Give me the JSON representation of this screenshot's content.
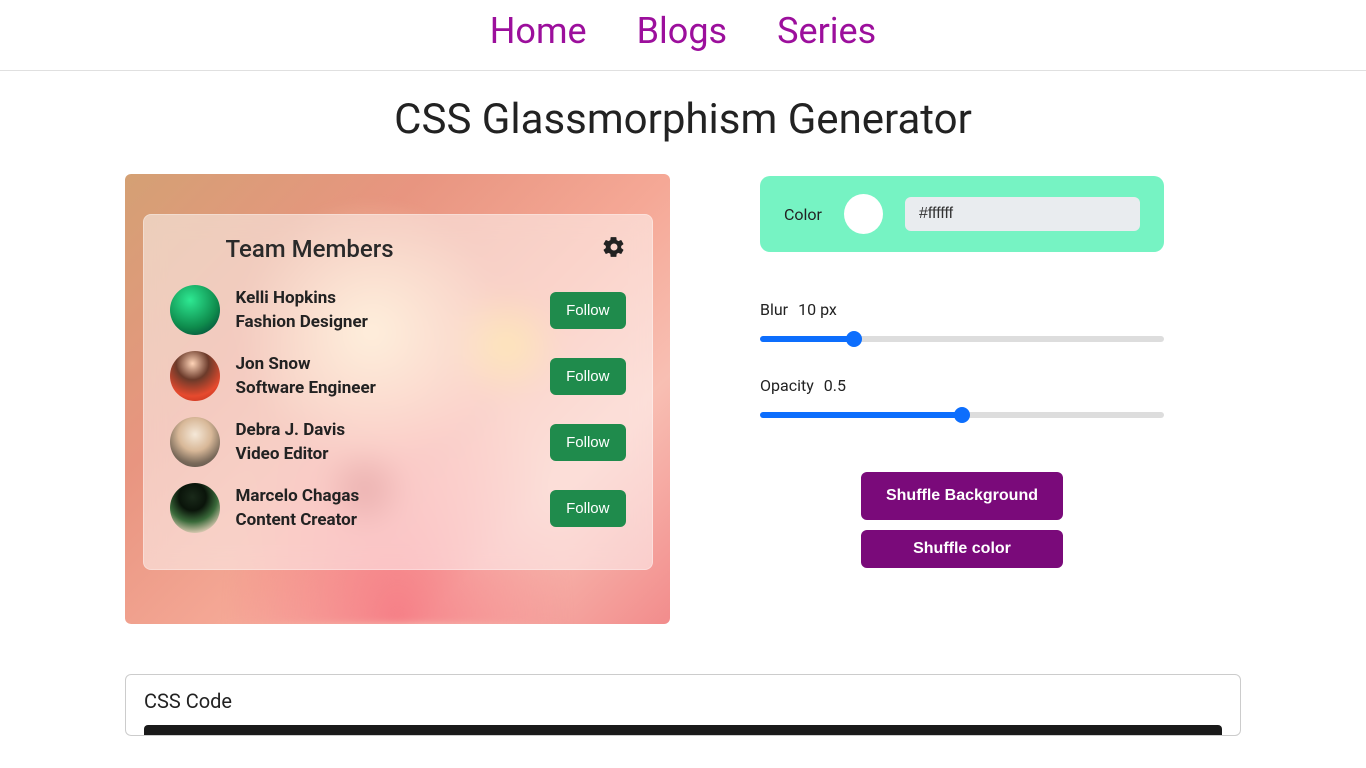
{
  "nav": {
    "home": "Home",
    "blogs": "Blogs",
    "series": "Series"
  },
  "page_title": "CSS Glassmorphism Generator",
  "card": {
    "title": "Team Members",
    "members": [
      {
        "name": "Kelli Hopkins",
        "role": "Fashion Designer"
      },
      {
        "name": "Jon Snow",
        "role": "Software Engineer"
      },
      {
        "name": "Debra J. Davis",
        "role": "Video Editor"
      },
      {
        "name": "Marcelo Chagas",
        "role": "Content Creator"
      }
    ],
    "follow_label": "Follow"
  },
  "controls": {
    "color_label": "Color",
    "color_value": "#ffffff",
    "blur_label": "Blur",
    "blur_value": "10 px",
    "opacity_label": "Opacity",
    "opacity_value": "0.5"
  },
  "buttons": {
    "shuffle_bg": "Shuffle Background",
    "shuffle_color": "Shuffle color"
  },
  "code": {
    "heading": "CSS Code"
  }
}
